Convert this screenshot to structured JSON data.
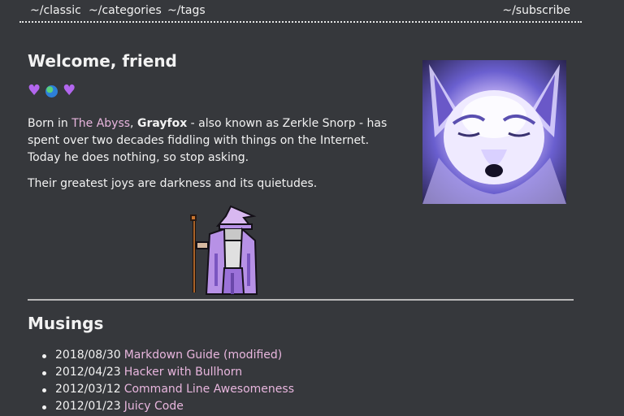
{
  "nav": {
    "classic": "~/classic",
    "categories": "~/categories",
    "tags": "~/tags",
    "subscribe": "~/subscribe"
  },
  "welcome": {
    "title": "Welcome, friend",
    "emojis": [
      "purple-heart",
      "globe",
      "purple-heart"
    ],
    "bio_born": "Born in ",
    "bio_place": "The Abyss",
    "bio_comma": ", ",
    "bio_name": "Grayfox",
    "bio_rest": " - also known as Zerkle Snorp - has spent over two decades fiddling with things on the Internet. Today he does nothing, so stop asking.",
    "joys": "Their greatest joys are darkness and its quietudes."
  },
  "musings": {
    "title": "Musings",
    "items": [
      {
        "date": "2018/08/30",
        "title": "Markdown Guide (modified)"
      },
      {
        "date": "2012/04/23",
        "title": "Hacker with Bullhorn"
      },
      {
        "date": "2012/03/12",
        "title": "Command Line Awesomeness"
      },
      {
        "date": "2012/01/23",
        "title": "Juicy Code"
      }
    ]
  },
  "colors": {
    "background": "#36383c",
    "text": "#f2f2f2",
    "link": "#e8b6de",
    "heart": "#b266ee"
  }
}
